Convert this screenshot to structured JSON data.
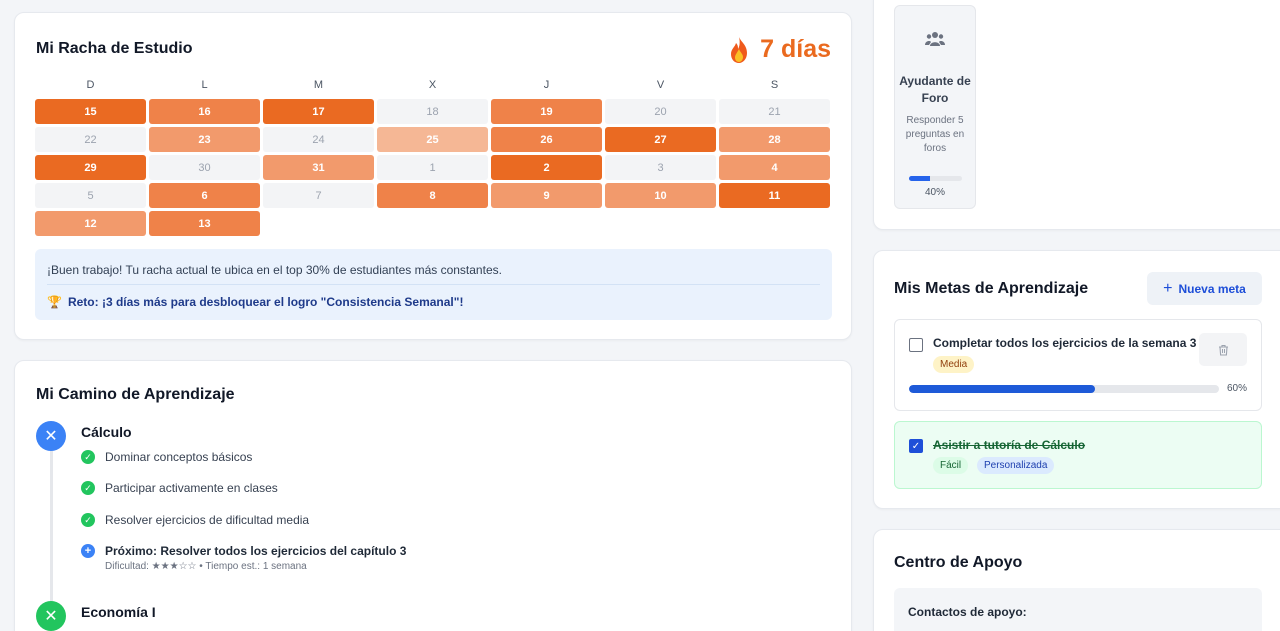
{
  "streak": {
    "title": "Mi Racha de Estudio",
    "count_label": "7 días",
    "weekdays": [
      "D",
      "L",
      "M",
      "X",
      "J",
      "V",
      "S"
    ],
    "days": [
      {
        "d": "15",
        "level": 4
      },
      {
        "d": "16",
        "level": 3
      },
      {
        "d": "17",
        "level": 4
      },
      {
        "d": "18",
        "level": 0
      },
      {
        "d": "19",
        "level": 3
      },
      {
        "d": "20",
        "level": 0
      },
      {
        "d": "21",
        "level": 0
      },
      {
        "d": "22",
        "level": 0
      },
      {
        "d": "23",
        "level": 2
      },
      {
        "d": "24",
        "level": 0
      },
      {
        "d": "25",
        "level": 1
      },
      {
        "d": "26",
        "level": 3
      },
      {
        "d": "27",
        "level": 4
      },
      {
        "d": "28",
        "level": 2
      },
      {
        "d": "29",
        "level": 4
      },
      {
        "d": "30",
        "level": 0
      },
      {
        "d": "31",
        "level": 2
      },
      {
        "d": "1",
        "level": 0
      },
      {
        "d": "2",
        "level": 4
      },
      {
        "d": "3",
        "level": 0
      },
      {
        "d": "4",
        "level": 2
      },
      {
        "d": "5",
        "level": 0
      },
      {
        "d": "6",
        "level": 3
      },
      {
        "d": "7",
        "level": 0
      },
      {
        "d": "8",
        "level": 3
      },
      {
        "d": "9",
        "level": 2
      },
      {
        "d": "10",
        "level": 2
      },
      {
        "d": "11",
        "level": 4
      },
      {
        "d": "12",
        "level": 2
      },
      {
        "d": "13",
        "level": 3
      }
    ],
    "message": "¡Buen trabajo! Tu racha actual te ubica en el top 30% de estudiantes más constantes.",
    "challenge": "Reto: ¡3 días más para desbloquear el logro \"Consistencia Semanal\"!"
  },
  "path": {
    "title": "Mi Camino de Aprendizaje",
    "courses": [
      {
        "name": "Cálculo",
        "steps": [
          "Dominar conceptos básicos",
          "Participar activamente en clases",
          "Resolver ejercicios de dificultad media"
        ],
        "next": "Próximo: Resolver todos los ejercicios del capítulo 3",
        "next_meta": "Dificultad: ★★★☆☆ • Tiempo est.: 1 semana"
      },
      {
        "name": "Economía I"
      }
    ]
  },
  "badge": {
    "name": "Ayudante de Foro",
    "description": "Responder 5 preguntas en foros",
    "progress": 0.4,
    "progress_label": "40%",
    "icon": "users-icon"
  },
  "goals": {
    "title": "Mis Metas de Aprendizaje",
    "new_button": "Nueva meta",
    "items": [
      {
        "text": "Completar todos los ejercicios de la semana 3",
        "tags": [
          "Media"
        ],
        "progress": 0.6,
        "progress_label": "60%",
        "done": false
      },
      {
        "text": "Asistir a tutoría de Cálculo",
        "tags": [
          "Fácil",
          "Personalizada"
        ],
        "done": true
      }
    ]
  },
  "support": {
    "title": "Centro de Apoyo",
    "contacts_label": "Contactos de apoyo:"
  },
  "colors": {
    "accent": "#ea6a1f",
    "primary": "#1e5ad8",
    "success": "#22c55e"
  }
}
